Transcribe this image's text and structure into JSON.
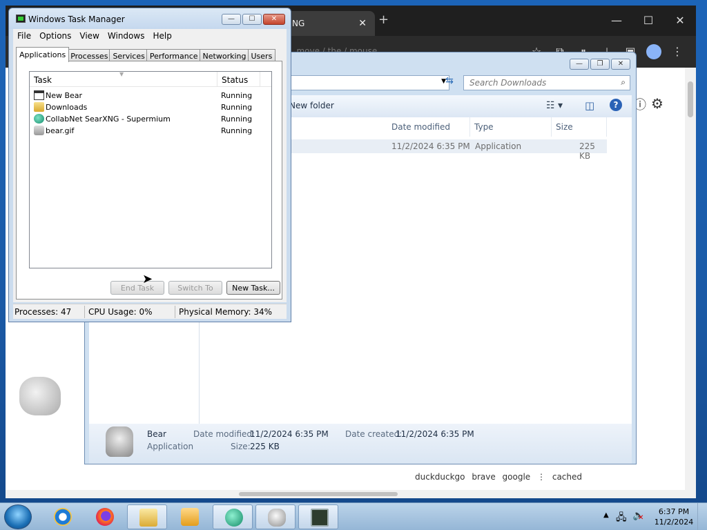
{
  "browser": {
    "tab_title": "NG",
    "tab_close": "✕",
    "new_tab": "+",
    "win_min": "—",
    "win_max": "☐",
    "win_close": "✕",
    "address_fragment": "...move / the / mouse",
    "bottom_links": [
      "duckduckgo",
      "brave",
      "google",
      "⋮",
      "cached"
    ]
  },
  "explorer": {
    "search_placeholder": "Search Downloads",
    "new_folder": "New folder",
    "columns": [
      "Date modified",
      "Type",
      "Size"
    ],
    "row": {
      "date": "11/2/2024 6:35 PM",
      "type": "Application",
      "size": "225 KB"
    },
    "details": {
      "name": "Bear",
      "type": "Application",
      "date_modified_label": "Date modified:",
      "date_modified": "11/2/2024 6:35 PM",
      "size_label": "Size:",
      "size": "225 KB",
      "date_created_label": "Date created:",
      "date_created": "11/2/2024 6:35 PM"
    }
  },
  "taskmgr": {
    "title": "Windows Task Manager",
    "menu": [
      "File",
      "Options",
      "View",
      "Windows",
      "Help"
    ],
    "tabs": [
      "Applications",
      "Processes",
      "Services",
      "Performance",
      "Networking",
      "Users"
    ],
    "col_task": "Task",
    "col_status": "Status",
    "tasks": [
      {
        "name": "New Bear",
        "status": "Running",
        "icon": "window-icon"
      },
      {
        "name": "Downloads",
        "status": "Running",
        "icon": "folder-icon"
      },
      {
        "name": "CollabNet SearXNG - Supermium",
        "status": "Running",
        "icon": "globe-icon"
      },
      {
        "name": "bear.gif",
        "status": "Running",
        "icon": "gif-icon"
      }
    ],
    "buttons": {
      "end_task": "End Task",
      "switch_to": "Switch To",
      "new_task": "New Task..."
    },
    "status": {
      "processes": "Processes: 47",
      "cpu": "CPU Usage: 0%",
      "memory": "Physical Memory: 34%"
    }
  },
  "taskbar": {
    "time": "6:37 PM",
    "date": "11/2/2024"
  }
}
